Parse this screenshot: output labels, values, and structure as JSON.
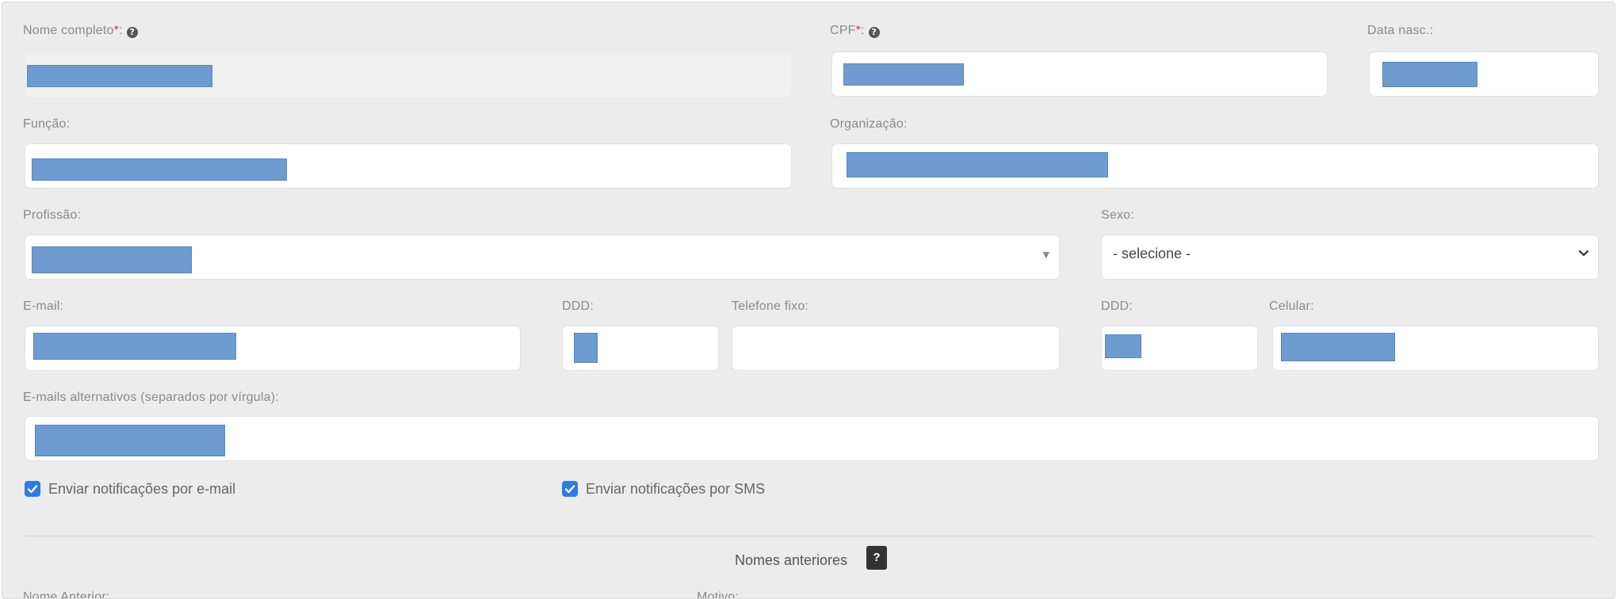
{
  "form": {
    "nome_completo": {
      "label": "Nome completo",
      "required": "*",
      "suffix": ":"
    },
    "cpf": {
      "label": "CPF",
      "required": "*",
      "suffix": ":"
    },
    "data_nasc": {
      "label": "Data nasc.:"
    },
    "funcao": {
      "label": "Função:"
    },
    "organizacao": {
      "label": "Organização:"
    },
    "profissao": {
      "label": "Profissão:"
    },
    "sexo": {
      "label": "Sexo:",
      "selected": "- selecione -"
    },
    "email": {
      "label": "E-mail:"
    },
    "ddd_fixo": {
      "label": "DDD:"
    },
    "telefone_fixo": {
      "label": "Telefone fixo:"
    },
    "ddd_celular": {
      "label": "DDD:"
    },
    "celular": {
      "label": "Celular:"
    },
    "emails_alternativos": {
      "label": "E-mails alternativos (separados por vírgula):"
    },
    "notificacoes": {
      "email_label": "Enviar notificações por e-mail",
      "email_checked": true,
      "sms_label": "Enviar notificações por SMS",
      "sms_checked": true
    }
  },
  "nomes_anteriores": {
    "title": "Nomes anteriores",
    "help_glyph": "?",
    "col_nome": "Nome Anterior:",
    "col_motivo": "Motivo:"
  },
  "icons": {
    "help": "question-circle-icon",
    "select_arrow": "triangle-down-icon",
    "select_chevron": "chevron-down-icon",
    "checkbox": "checkmark-icon"
  },
  "colors": {
    "panel_bg": "#ececec",
    "field_bg": "#ffffff",
    "label": "#8a8a8a",
    "required": "#e0392b",
    "checkbox": "#2f7ae5",
    "redaction": "#6e9bd0"
  }
}
